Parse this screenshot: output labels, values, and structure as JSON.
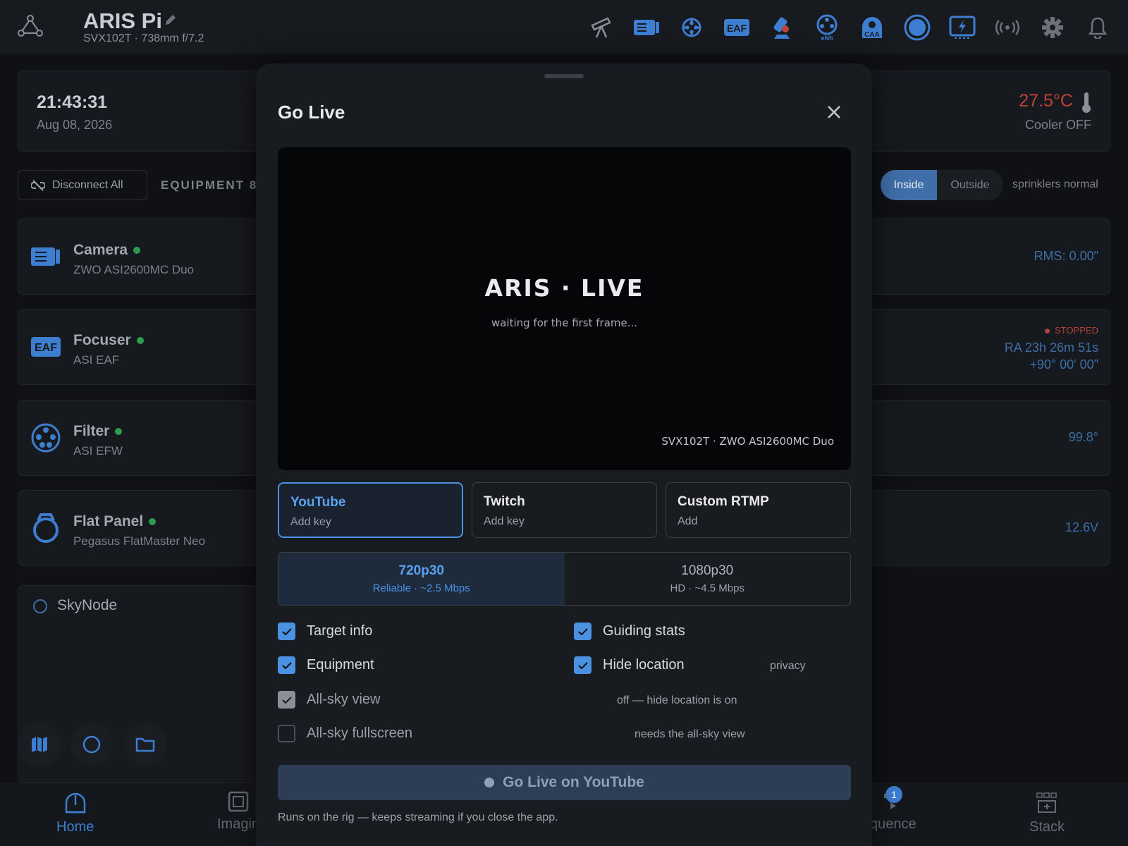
{
  "topbar": {
    "title": "ARIS Pi",
    "subtitle": "SVX102T · 738mm f/7.2",
    "icons": [
      "telescope-icon",
      "camera-icon",
      "guider-icon",
      "eaf-icon",
      "mount-icon",
      "filter-wheel-icon",
      "caa-icon",
      "flat-panel-icon",
      "power-box-icon",
      "wireless-icon",
      "gear-icon",
      "bell-icon"
    ],
    "eaf_text": "EAF",
    "ewh_text": "eNh",
    "caa_text": "CAA"
  },
  "clock": {
    "time": "21:43:31",
    "date": "Aug 08, 2026",
    "temperature": "27.5°C",
    "cooler": "Cooler OFF"
  },
  "toolbar": {
    "disconnect_label": "Disconnect All",
    "equipment_label": "EQUIPMENT 8",
    "inside_label": "Inside",
    "outside_label": "Outside",
    "sprinklers": "sprinklers normal"
  },
  "devices": [
    {
      "name": "Camera",
      "model": "ZWO ASI2600MC Duo",
      "value": "RMS: 0.00\""
    },
    {
      "name": "Focuser",
      "model": "ASI EAF",
      "status": "STOPPED",
      "ra": "RA 23h 26m 51s",
      "dec": "+90° 00' 00\""
    },
    {
      "name": "Filter",
      "model": "ASI EFW",
      "value": "99.8°"
    },
    {
      "name": "Flat Panel",
      "model": "Pegasus FlatMaster Neo",
      "value": "12.6V"
    }
  ],
  "skynode": {
    "name": "SkyNode"
  },
  "bottomnav": {
    "home": "Home",
    "imaging": "Imagin",
    "sequence": "quence",
    "stack": "Stack",
    "sequence_badge": "1"
  },
  "modal": {
    "title": "Go Live",
    "preview": {
      "title": "ARIS · LIVE",
      "subtitle": "waiting for the first frame...",
      "caption": "SVX102T · ZWO ASI2600MC Duo"
    },
    "platforms": [
      {
        "name": "YouTube",
        "sub": "Add key",
        "selected": true
      },
      {
        "name": "Twitch",
        "sub": "Add key",
        "selected": false
      },
      {
        "name": "Custom RTMP",
        "sub": "Add",
        "selected": false
      }
    ],
    "qualities": [
      {
        "name": "720p30",
        "sub": "Reliable · ~2.5 Mbps",
        "selected": true
      },
      {
        "name": "1080p30",
        "sub": "HD · ~4.5 Mbps",
        "selected": false
      }
    ],
    "options": {
      "target_info": "Target info",
      "guiding_stats": "Guiding stats",
      "equipment": "Equipment",
      "hide_location": "Hide location",
      "hide_location_note": "privacy",
      "allsky_view": "All-sky view",
      "allsky_view_note": "off — hide location is on",
      "allsky_fullscreen": "All-sky fullscreen",
      "allsky_fullscreen_note": "needs the all-sky view"
    },
    "go_live_label": "Go Live on YouTube",
    "footer_note": "Runs on the rig — keeps streaming if you close the app."
  },
  "colors": {
    "accent": "#4a91e2",
    "background": "#0f1115",
    "warning_red": "#c0413a",
    "online_green": "#2e9c4e"
  }
}
